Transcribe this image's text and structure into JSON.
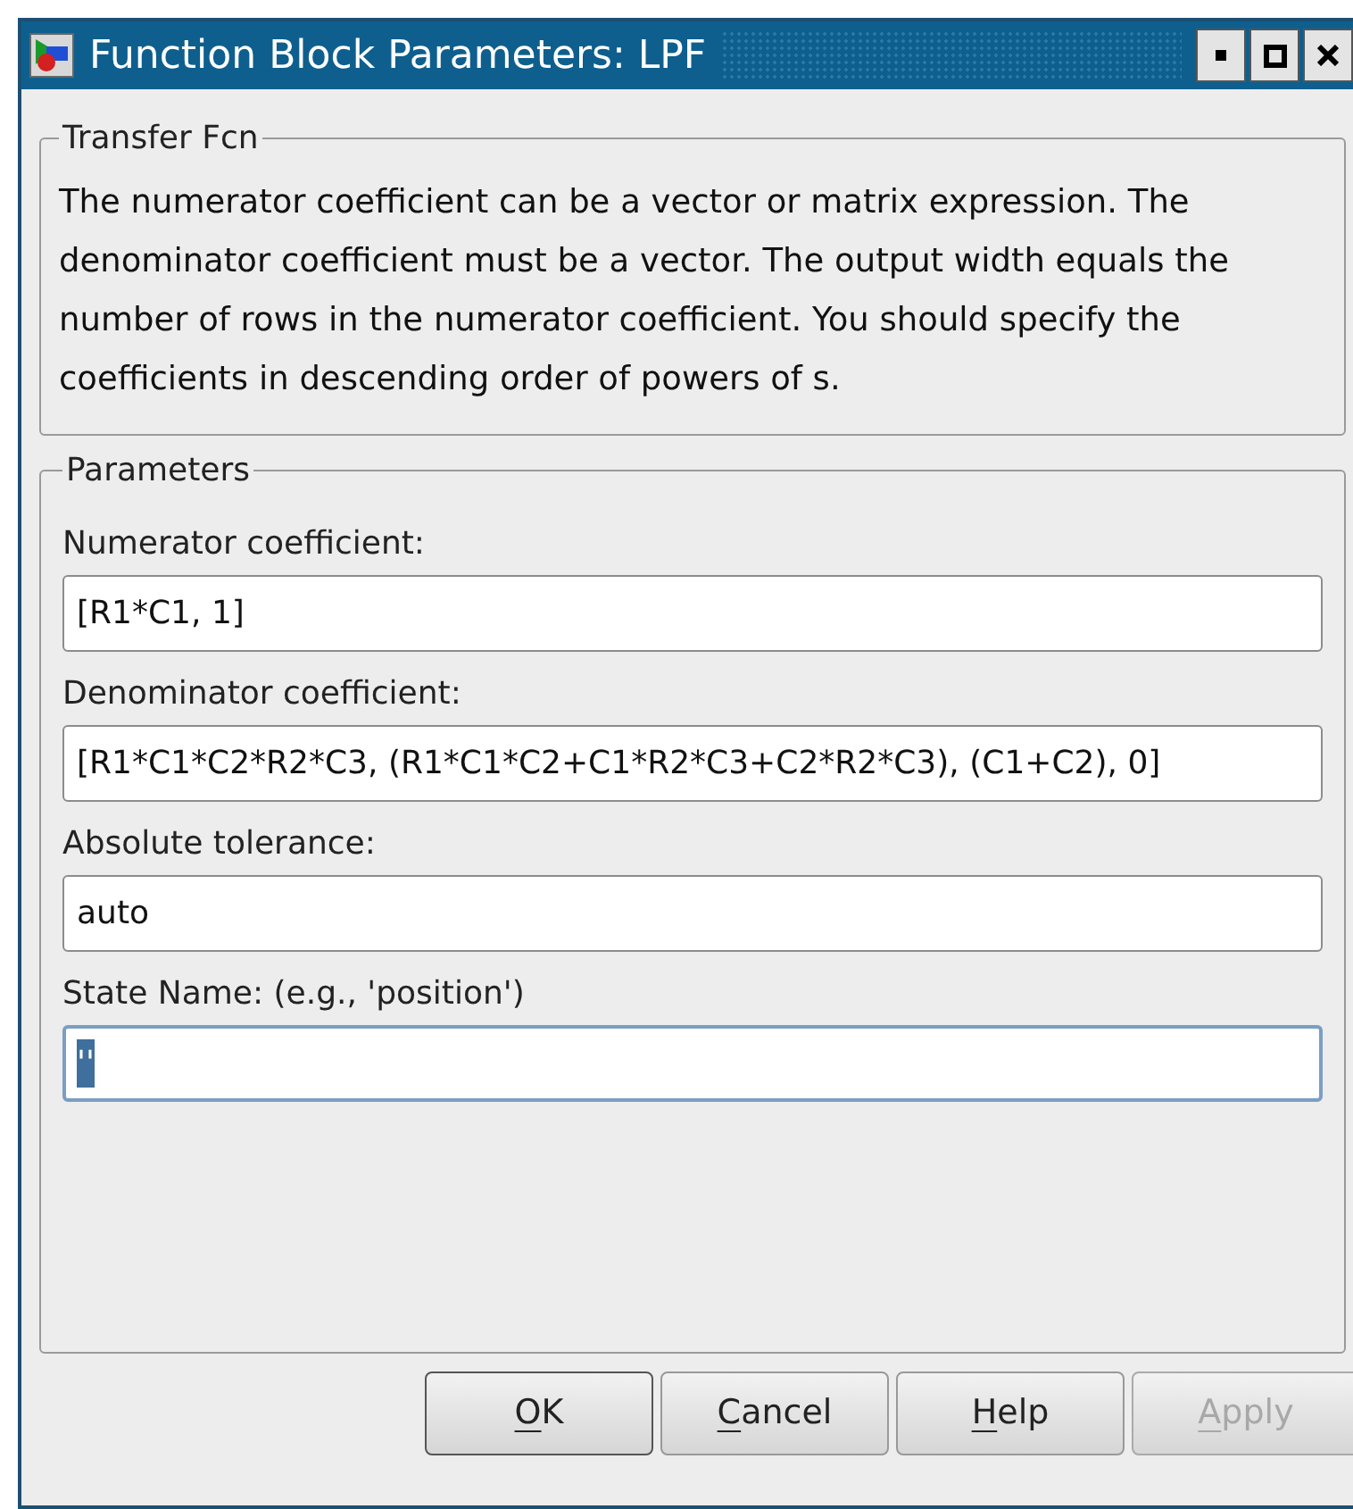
{
  "window": {
    "title": "Function Block Parameters: LPF"
  },
  "description_group": {
    "title": "Transfer Fcn",
    "text": "The numerator coefficient can be a vector or matrix expression. The denominator coefficient must be a vector. The output width equals the number of rows in the numerator coefficient. You should specify the coefficients in descending order of powers of s."
  },
  "parameters_group": {
    "title": "Parameters",
    "fields": [
      {
        "label": "Numerator coefficient:",
        "value": "[R1*C1, 1]",
        "focused": false
      },
      {
        "label": "Denominator coefficient:",
        "value": "[R1*C1*C2*R2*C3, (R1*C1*C2+C1*R2*C3+C2*R2*C3), (C1+C2), 0]",
        "focused": false
      },
      {
        "label": "Absolute tolerance:",
        "value": "auto",
        "focused": false
      },
      {
        "label": "State Name: (e.g., 'position')",
        "value": "''",
        "focused": true
      }
    ]
  },
  "buttons": [
    {
      "label": "OK",
      "disabled": false
    },
    {
      "label": "Cancel",
      "disabled": false
    },
    {
      "label": "Help",
      "disabled": false
    },
    {
      "label": "Apply",
      "disabled": true
    }
  ]
}
